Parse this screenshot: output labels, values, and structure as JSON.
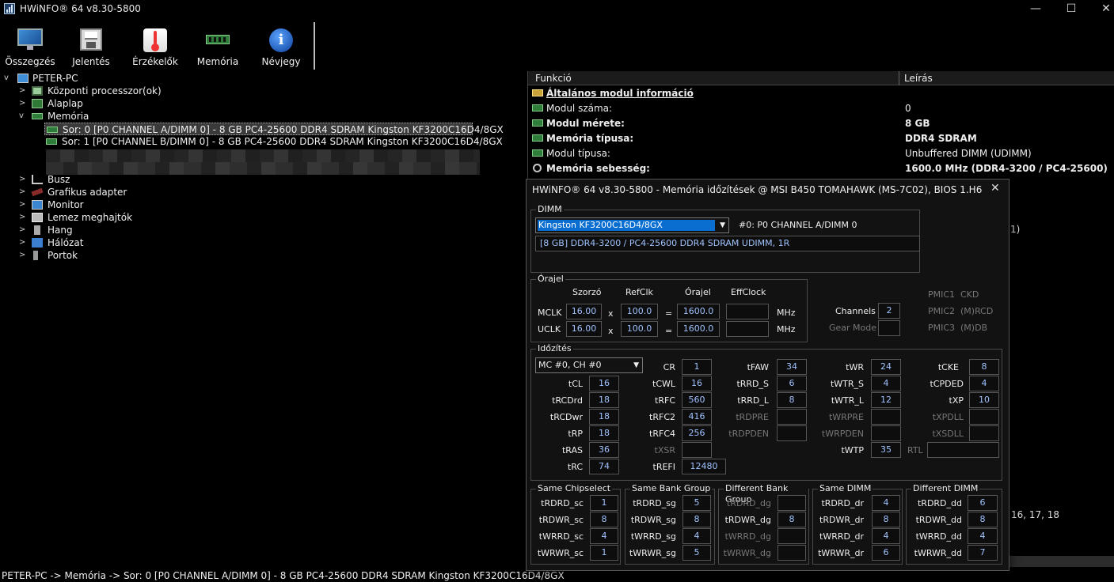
{
  "window": {
    "title": "HWiNFO® 64 v8.30-5800",
    "min_glyph": "—",
    "max_glyph": "☐",
    "close_glyph": "✕"
  },
  "toolbar": {
    "summary": "Összegzés",
    "report": "Jelentés",
    "sensors": "Érzékelők",
    "memory": "Memória",
    "about": "Névjegy",
    "about_glyph": "i"
  },
  "tree": {
    "root": "PETER-PC",
    "cpu": "Központi processzor(ok)",
    "mobo": "Alaplap",
    "memory": "Memória",
    "slot0": "Sor: 0 [P0 CHANNEL A/DIMM 0] - 8 GB PC4-25600 DDR4 SDRAM Kingston KF3200C16D4/8GX",
    "slot1": "Sor: 1 [P0 CHANNEL B/DIMM 0] - 8 GB PC4-25600 DDR4 SDRAM Kingston KF3200C16D4/8GX",
    "bus": "Busz",
    "gpu": "Grafikus adapter",
    "monitor": "Monitor",
    "disks": "Lemez meghajtók",
    "sound": "Hang",
    "network": "Hálózat",
    "ports": "Portok",
    "expanded_glyph": "v",
    "collapsed_glyph": ">"
  },
  "details": {
    "col_function": "Funkció",
    "col_description": "Leírás",
    "section": "Általános modul információ",
    "rows": [
      {
        "name": "Modul száma:",
        "value": "0"
      },
      {
        "name": "Modul mérete:",
        "value": "8 GB"
      },
      {
        "name": "Memória típusa:",
        "value": "DDR4 SDRAM"
      },
      {
        "name": "Modul típusa:",
        "value": "Unbuffered DIMM (UDIMM)"
      },
      {
        "name": "Memória sebesség:",
        "value": "1600.0 MHz (DDR4-3200 / PC4-25600)"
      }
    ],
    "fragment_paren": "1)",
    "fragment_numbers": "16, 17, 18"
  },
  "status_bar": "PETER-PC -> Memória -> Sor: 0 [P0 CHANNEL A/DIMM 0] - 8 GB PC4-25600 DDR4 SDRAM Kingston KF3200C16D4/8GX",
  "dialog": {
    "title": "HWiNFO® 64 v8.30-5800 - Memória időzítések @ MSI B450 TOMAHAWK (MS-7C02), BIOS 1.H6",
    "close_glyph": "✕",
    "dimm": {
      "group": "DIMM",
      "selected": "Kingston KF3200C16D4/8GX",
      "slot": "#0: P0 CHANNEL A/DIMM 0",
      "summary": "[8 GB] DDR4-3200 / PC4-25600 DDR4 SDRAM UDIMM, 1R",
      "arrow": "▼"
    },
    "clock": {
      "group": "Órajel",
      "h_mult": "Szorzó",
      "h_ref": "RefClk",
      "h_clock": "Órajel",
      "h_eff": "EffClock",
      "mclk": {
        "label": "MCLK",
        "mult": "16.00",
        "x": "x",
        "ref": "100.0",
        "eq": "=",
        "clock": "1600.0",
        "eff": "",
        "unit": "MHz"
      },
      "uclk": {
        "label": "UCLK",
        "mult": "16.00",
        "x": "x",
        "ref": "100.0",
        "eq": "=",
        "clock": "1600.0",
        "eff": "",
        "unit": "MHz"
      },
      "channels_label": "Channels",
      "channels": "2",
      "gear_label": "Gear Mode",
      "gear": "",
      "pmic1": "PMIC1",
      "pmic1_v": "CKD",
      "pmic2": "PMIC2",
      "pmic2_v": "(M)RCD",
      "pmic3": "PMIC3",
      "pmic3_v": "(M)DB"
    },
    "timing": {
      "group": "Időzítés",
      "mc": "MC #0, CH #0",
      "arrow": "▼",
      "tCL": "16",
      "tRCDrd": "18",
      "tRCDwr": "18",
      "tRP": "18",
      "tRAS": "36",
      "tRC": "74",
      "CR": "1",
      "tCWL": "16",
      "tRFC": "560",
      "tRFC2": "416",
      "tRFC4": "256",
      "tXSR": "",
      "tREFI": "12480",
      "tFAW": "34",
      "tRRD_S": "6",
      "tRRD_L": "8",
      "tRDPRE": "",
      "tRDPDEN": "",
      "tWR": "24",
      "tWTR_S": "4",
      "tWTR_L": "12",
      "tWRPRE": "",
      "tWRPDEN": "",
      "tWTP": "35",
      "tCKE": "8",
      "tCPDED": "4",
      "tXP": "10",
      "tXPDLL": "",
      "tXSDLL": "",
      "RTL": ""
    },
    "groups": {
      "sc": {
        "title": "Same Chipselect",
        "l1": "tRDRD_sc",
        "v1": "1",
        "l2": "tRDWR_sc",
        "v2": "8",
        "l3": "tWRRD_sc",
        "v3": "4",
        "l4": "tWRWR_sc",
        "v4": "1"
      },
      "sg": {
        "title": "Same Bank Group",
        "l1": "tRDRD_sg",
        "v1": "5",
        "l2": "tRDWR_sg",
        "v2": "8",
        "l3": "tWRRD_sg",
        "v3": "4",
        "l4": "tWRWR_sg",
        "v4": "5"
      },
      "dg": {
        "title": "Different Bank Group",
        "l1": "tRDRD_dg",
        "v1": "",
        "l2": "tRDWR_dg",
        "v2": "8",
        "l3": "tWRRD_dg",
        "v3": "",
        "l4": "tWRWR_dg",
        "v4": ""
      },
      "dr": {
        "title": "Same DIMM",
        "l1": "tRDRD_dr",
        "v1": "4",
        "l2": "tRDWR_dr",
        "v2": "8",
        "l3": "tWRRD_dr",
        "v3": "4",
        "l4": "tWRWR_dr",
        "v4": "6"
      },
      "dd": {
        "title": "Different DIMM",
        "l1": "tRDRD_dd",
        "v1": "6",
        "l2": "tRDWR_dd",
        "v2": "8",
        "l3": "tWRRD_dd",
        "v3": "4",
        "l4": "tWRWR_dd",
        "v4": "7"
      }
    }
  }
}
